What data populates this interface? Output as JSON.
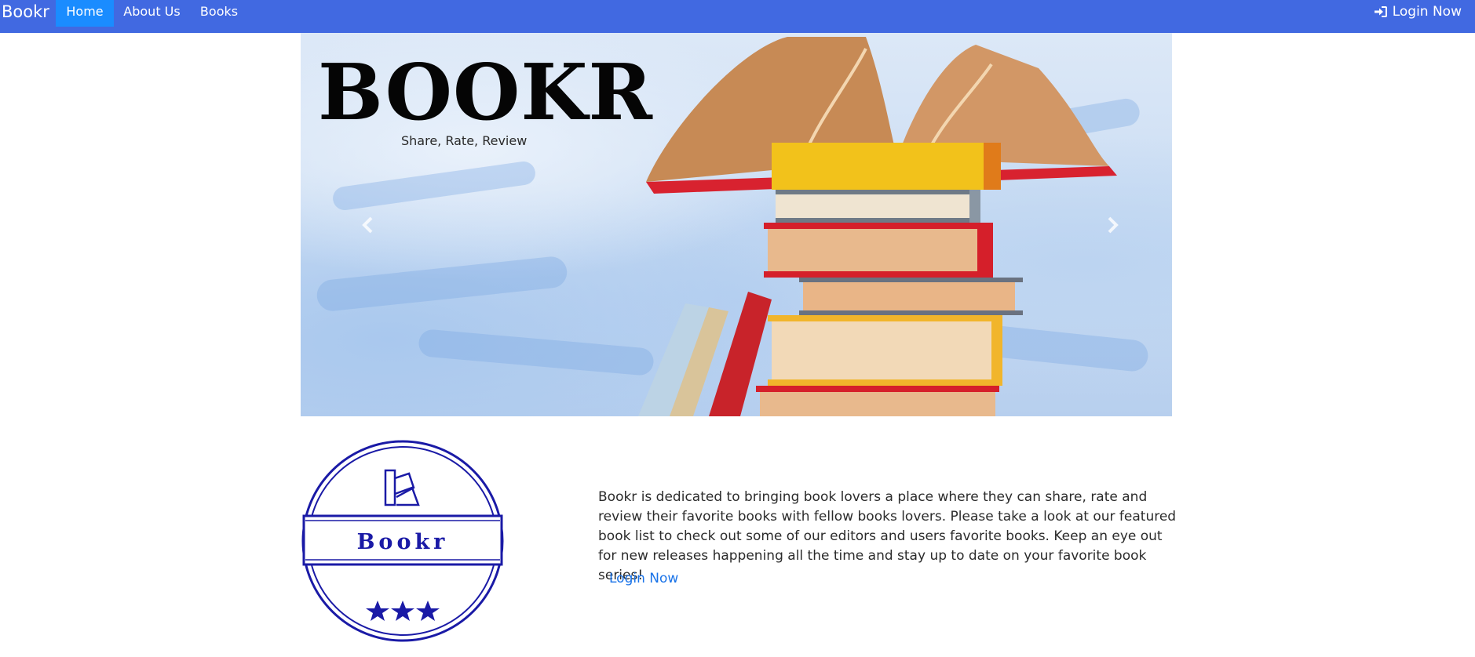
{
  "nav": {
    "brand": "Bookr",
    "items": [
      {
        "label": "Home",
        "active": true
      },
      {
        "label": "About Us",
        "active": false
      },
      {
        "label": "Books",
        "active": false
      }
    ],
    "login_label": "Login Now",
    "login_icon": "sign-in-icon"
  },
  "hero": {
    "title": "BOOKR",
    "subtitle": "Share, Rate, Review",
    "prev_icon": "chevron-left-icon",
    "next_icon": "chevron-right-icon"
  },
  "badge": {
    "name": "Bookr",
    "icon": "color-swatch-icon",
    "stars": 3
  },
  "about": {
    "text": "Bookr is dedicated to bringing book lovers a place where they can share, rate and review their favorite books with fellow books lovers. Please take a look at our featured book list to check out some of our editors and users favorite books. Keep an eye out for new releases happening all the time and stay up to date on your favorite book series!",
    "login_label": "Login Now"
  },
  "colors": {
    "navbar": "#4169e1",
    "nav_active": "#1a8cff",
    "badge": "#1a1aa6",
    "link": "#1a73e8"
  }
}
